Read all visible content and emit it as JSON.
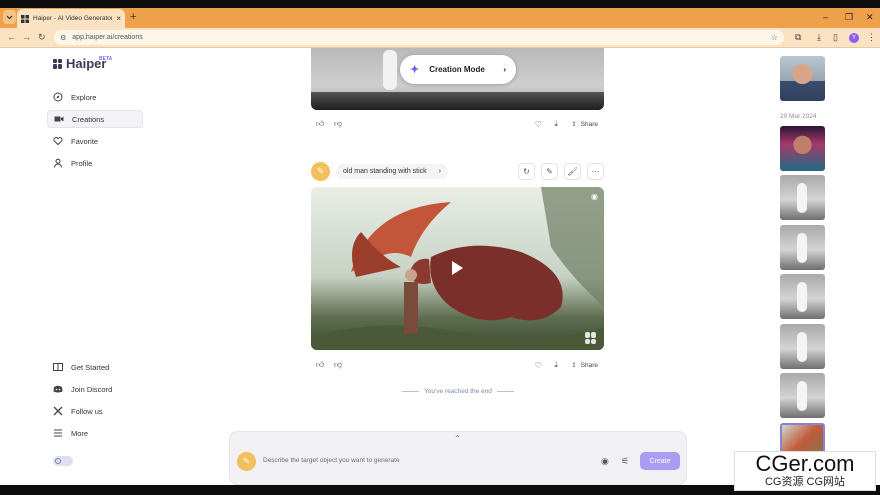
{
  "browser": {
    "tab_title": "Haiper - AI Video Generator",
    "url": "app.haiper.ai/creations",
    "profile_initial": "Y",
    "new_tab_label": "+"
  },
  "app": {
    "logo_text": "Haiper",
    "beta_label": "BETA"
  },
  "sidebar": {
    "items": [
      {
        "label": "Explore",
        "icon": "compass-icon"
      },
      {
        "label": "Creations",
        "icon": "video-icon"
      },
      {
        "label": "Favorite",
        "icon": "heart-icon"
      },
      {
        "label": "Profile",
        "icon": "user-icon"
      }
    ],
    "footer": [
      {
        "label": "Get Started",
        "icon": "book-icon"
      },
      {
        "label": "Join Discord",
        "icon": "discord-icon"
      },
      {
        "label": "Follow us",
        "icon": "x-logo-icon"
      },
      {
        "label": "More",
        "icon": "menu-icon"
      }
    ]
  },
  "feed": {
    "creation_mode_label": "Creation Mode",
    "share_label": "Share",
    "prompt_text": "old man standing with stick",
    "end_message": "You've reached the end"
  },
  "composer": {
    "placeholder": "Describe the target object you want to generate",
    "create_label": "Create"
  },
  "right_sidebar": {
    "dates": [
      "20 Mar 2024"
    ]
  },
  "watermark": {
    "site": "CGer.com",
    "sub": "CG资源 CG网站"
  }
}
